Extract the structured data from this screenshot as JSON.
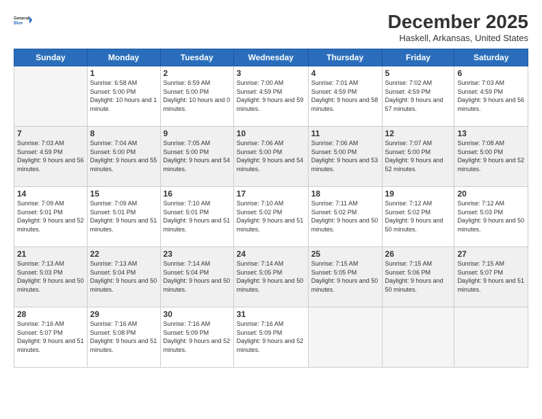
{
  "logo": {
    "line1": "General",
    "line2": "Blue"
  },
  "title": "December 2025",
  "subtitle": "Haskell, Arkansas, United States",
  "days_of_week": [
    "Sunday",
    "Monday",
    "Tuesday",
    "Wednesday",
    "Thursday",
    "Friday",
    "Saturday"
  ],
  "weeks": [
    [
      {
        "day": "",
        "empty": true
      },
      {
        "day": "1",
        "sunrise": "6:58 AM",
        "sunset": "5:00 PM",
        "daylight": "10 hours and 1 minute."
      },
      {
        "day": "2",
        "sunrise": "6:59 AM",
        "sunset": "5:00 PM",
        "daylight": "10 hours and 0 minutes."
      },
      {
        "day": "3",
        "sunrise": "7:00 AM",
        "sunset": "4:59 PM",
        "daylight": "9 hours and 59 minutes."
      },
      {
        "day": "4",
        "sunrise": "7:01 AM",
        "sunset": "4:59 PM",
        "daylight": "9 hours and 58 minutes."
      },
      {
        "day": "5",
        "sunrise": "7:02 AM",
        "sunset": "4:59 PM",
        "daylight": "9 hours and 57 minutes."
      },
      {
        "day": "6",
        "sunrise": "7:03 AM",
        "sunset": "4:59 PM",
        "daylight": "9 hours and 56 minutes."
      }
    ],
    [
      {
        "day": "7",
        "sunrise": "7:03 AM",
        "sunset": "4:59 PM",
        "daylight": "9 hours and 56 minutes."
      },
      {
        "day": "8",
        "sunrise": "7:04 AM",
        "sunset": "5:00 PM",
        "daylight": "9 hours and 55 minutes."
      },
      {
        "day": "9",
        "sunrise": "7:05 AM",
        "sunset": "5:00 PM",
        "daylight": "9 hours and 54 minutes."
      },
      {
        "day": "10",
        "sunrise": "7:06 AM",
        "sunset": "5:00 PM",
        "daylight": "9 hours and 54 minutes."
      },
      {
        "day": "11",
        "sunrise": "7:06 AM",
        "sunset": "5:00 PM",
        "daylight": "9 hours and 53 minutes."
      },
      {
        "day": "12",
        "sunrise": "7:07 AM",
        "sunset": "5:00 PM",
        "daylight": "9 hours and 52 minutes."
      },
      {
        "day": "13",
        "sunrise": "7:08 AM",
        "sunset": "5:00 PM",
        "daylight": "9 hours and 52 minutes."
      }
    ],
    [
      {
        "day": "14",
        "sunrise": "7:09 AM",
        "sunset": "5:01 PM",
        "daylight": "9 hours and 52 minutes."
      },
      {
        "day": "15",
        "sunrise": "7:09 AM",
        "sunset": "5:01 PM",
        "daylight": "9 hours and 51 minutes."
      },
      {
        "day": "16",
        "sunrise": "7:10 AM",
        "sunset": "5:01 PM",
        "daylight": "9 hours and 51 minutes."
      },
      {
        "day": "17",
        "sunrise": "7:10 AM",
        "sunset": "5:02 PM",
        "daylight": "9 hours and 51 minutes."
      },
      {
        "day": "18",
        "sunrise": "7:11 AM",
        "sunset": "5:02 PM",
        "daylight": "9 hours and 50 minutes."
      },
      {
        "day": "19",
        "sunrise": "7:12 AM",
        "sunset": "5:02 PM",
        "daylight": "9 hours and 50 minutes."
      },
      {
        "day": "20",
        "sunrise": "7:12 AM",
        "sunset": "5:03 PM",
        "daylight": "9 hours and 50 minutes."
      }
    ],
    [
      {
        "day": "21",
        "sunrise": "7:13 AM",
        "sunset": "5:03 PM",
        "daylight": "9 hours and 50 minutes."
      },
      {
        "day": "22",
        "sunrise": "7:13 AM",
        "sunset": "5:04 PM",
        "daylight": "9 hours and 50 minutes."
      },
      {
        "day": "23",
        "sunrise": "7:14 AM",
        "sunset": "5:04 PM",
        "daylight": "9 hours and 50 minutes."
      },
      {
        "day": "24",
        "sunrise": "7:14 AM",
        "sunset": "5:05 PM",
        "daylight": "9 hours and 50 minutes."
      },
      {
        "day": "25",
        "sunrise": "7:15 AM",
        "sunset": "5:05 PM",
        "daylight": "9 hours and 50 minutes."
      },
      {
        "day": "26",
        "sunrise": "7:15 AM",
        "sunset": "5:06 PM",
        "daylight": "9 hours and 50 minutes."
      },
      {
        "day": "27",
        "sunrise": "7:15 AM",
        "sunset": "5:07 PM",
        "daylight": "9 hours and 51 minutes."
      }
    ],
    [
      {
        "day": "28",
        "sunrise": "7:16 AM",
        "sunset": "5:07 PM",
        "daylight": "9 hours and 51 minutes."
      },
      {
        "day": "29",
        "sunrise": "7:16 AM",
        "sunset": "5:08 PM",
        "daylight": "9 hours and 51 minutes."
      },
      {
        "day": "30",
        "sunrise": "7:16 AM",
        "sunset": "5:09 PM",
        "daylight": "9 hours and 52 minutes."
      },
      {
        "day": "31",
        "sunrise": "7:16 AM",
        "sunset": "5:09 PM",
        "daylight": "9 hours and 52 minutes."
      },
      {
        "day": "",
        "empty": true
      },
      {
        "day": "",
        "empty": true
      },
      {
        "day": "",
        "empty": true
      }
    ]
  ]
}
